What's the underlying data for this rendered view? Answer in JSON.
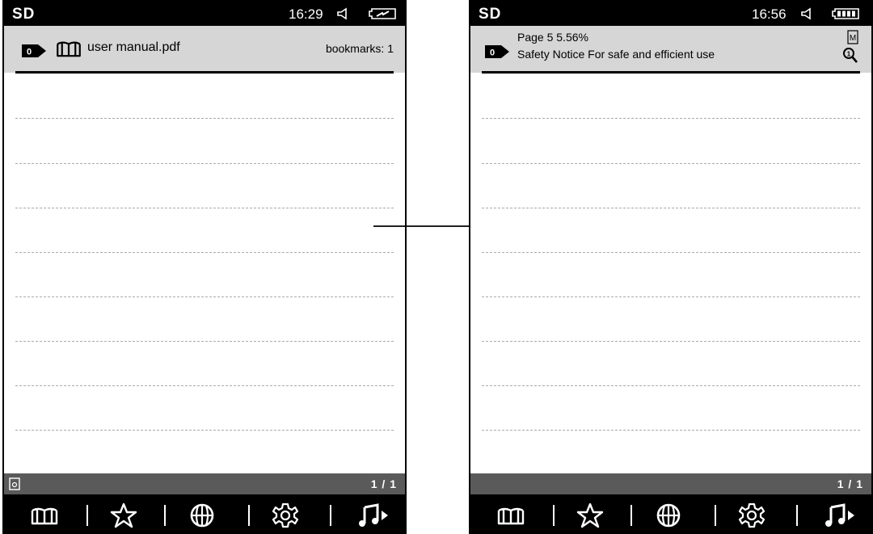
{
  "left_screen": {
    "status": {
      "storage": "SD",
      "time": "16:29",
      "battery": "charging"
    },
    "header": {
      "tag": "0",
      "file_name": "user manual.pdf",
      "bookmarks": "bookmarks: 1"
    },
    "footer": {
      "page": "1 / 1"
    },
    "toolbar": [
      "library-icon",
      "favorites-icon",
      "browser-icon",
      "settings-icon",
      "music-icon"
    ]
  },
  "right_screen": {
    "status": {
      "storage": "SD",
      "time": "16:56",
      "battery": "full"
    },
    "header": {
      "tag": "0",
      "page_info": "Page 5  5.56%",
      "chapter": "Safety Notice For safe and efficient use"
    },
    "footer": {
      "page": "1 / 1"
    },
    "toolbar": [
      "library-icon",
      "favorites-icon",
      "browser-icon",
      "settings-icon",
      "music-icon"
    ]
  },
  "colors": {
    "status_bar": "#000000",
    "header": "#d6d6d6",
    "footer": "#5a5a5a",
    "toolbar": "#000000"
  }
}
